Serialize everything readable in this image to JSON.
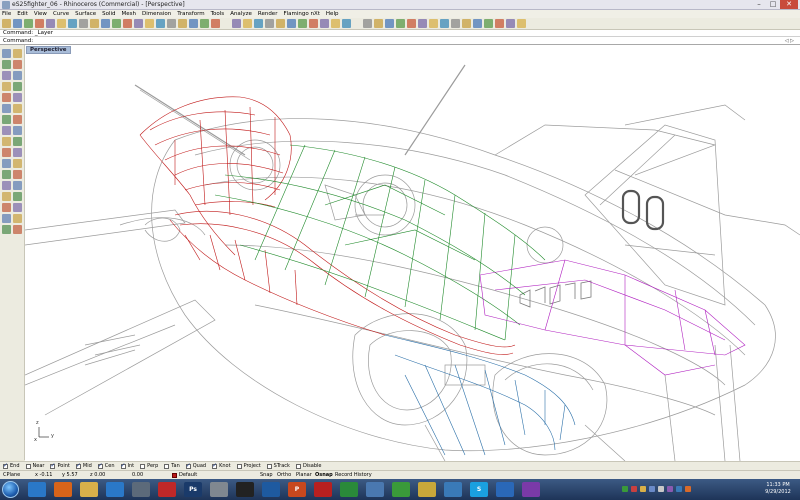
{
  "window": {
    "title": "eS25fighter_06 - Rhinoceros (Commercial) - [Perspective]"
  },
  "menu": [
    "File",
    "Edit",
    "View",
    "Curve",
    "Surface",
    "Solid",
    "Mesh",
    "Dimension",
    "Transform",
    "Tools",
    "Analyze",
    "Render",
    "Flamingo nXt",
    "Help"
  ],
  "toolbar": {
    "icons": [
      "new-icon",
      "open-icon",
      "save-icon",
      "print-icon",
      "import-icon",
      "cut-icon",
      "copy-icon",
      "paste-icon",
      "undo-icon",
      "redo-icon",
      "pan-icon",
      "rotate-icon",
      "zoom-icon",
      "zoom-window-icon",
      "zoom-extents-icon",
      "zoom-selected-icon",
      "zoom-target-icon",
      "undo-view-icon",
      "four-view-icon",
      "cplane-icon",
      "layer-icon",
      "properties-icon",
      "select-icon",
      "lights-icon",
      "rectangle-icon",
      "ellipse-icon",
      "select-points-icon",
      "ghosted-icon",
      "wireframe-icon",
      "shaded-icon",
      "rendered-icon",
      "render-icon",
      "lock-icon",
      "hide-icon",
      "snap-icon",
      "grid-icon",
      "analysis-icon",
      "options-icon",
      "mesh-icon",
      "flamingo-icon",
      "material-icon",
      "environment-icon",
      "light-icon",
      "camera-icon",
      "render-preview-icon",
      "help-icon"
    ]
  },
  "command": {
    "history": "Command: _Layer",
    "prompt_label": "Command:",
    "nav_arrows": "◁ ▷"
  },
  "viewport": {
    "tab_label": "Perspective",
    "axis_x": "x",
    "axis_y": "y",
    "axis_z": "z",
    "colors": {
      "background": "#ffffff",
      "red_wire": "#c01818",
      "green_wire": "#1f8a2a",
      "blue_wire": "#2a6fa8",
      "magenta_wire": "#b020c0",
      "grey_wire": "#7a7a7a"
    }
  },
  "osnap": [
    {
      "label": "End",
      "checked": true
    },
    {
      "label": "Near",
      "checked": false
    },
    {
      "label": "Point",
      "checked": true
    },
    {
      "label": "Mid",
      "checked": true
    },
    {
      "label": "Cen",
      "checked": true
    },
    {
      "label": "Int",
      "checked": true
    },
    {
      "label": "Perp",
      "checked": false
    },
    {
      "label": "Tan",
      "checked": false
    },
    {
      "label": "Quad",
      "checked": true
    },
    {
      "label": "Knot",
      "checked": true
    },
    {
      "label": "Project",
      "checked": false
    },
    {
      "label": "STrack",
      "checked": false
    },
    {
      "label": "Disable",
      "checked": false
    }
  ],
  "status": {
    "cplane": "CPlane",
    "x": "x -0.11",
    "y": "y 5.57",
    "z": "z 0.00",
    "distance": "0.00",
    "layer": "Default",
    "layer_color": "#b81818",
    "snap": "Snap",
    "ortho": "Ortho",
    "planar": "Planar",
    "osnap": "Osnap",
    "record_history": "Record History"
  },
  "taskbar": {
    "apps": [
      {
        "name": "ie-icon",
        "label": "",
        "color": "#2a78c8"
      },
      {
        "name": "firefox-icon",
        "label": "",
        "color": "#d8641a"
      },
      {
        "name": "explorer-icon",
        "label": "",
        "color": "#d8b04a"
      },
      {
        "name": "media-player-icon",
        "label": "",
        "color": "#2a78c8"
      },
      {
        "name": "rhino-icon",
        "label": "",
        "color": "#5c6a7a"
      },
      {
        "name": "autodesk-icon",
        "label": "",
        "color": "#c02828"
      },
      {
        "name": "photoshop-icon",
        "label": "Ps",
        "color": "#1a3a6a"
      },
      {
        "name": "alias-icon",
        "label": "",
        "color": "#808890"
      },
      {
        "name": "zbrush-icon",
        "label": "",
        "color": "#222222"
      },
      {
        "name": "keyshot-icon",
        "label": "",
        "color": "#1e5aa0"
      },
      {
        "name": "powerpoint-icon",
        "label": "P",
        "color": "#c8481e"
      },
      {
        "name": "pdf-icon",
        "label": "",
        "color": "#b82020"
      },
      {
        "name": "chrome-icon",
        "label": "",
        "color": "#2a8a3a"
      },
      {
        "name": "app-icon",
        "label": "",
        "color": "#4a78b0"
      },
      {
        "name": "chat-icon",
        "label": "",
        "color": "#3a9a3a"
      },
      {
        "name": "notes-icon",
        "label": "",
        "color": "#c8a83a"
      },
      {
        "name": "network-icon",
        "label": "",
        "color": "#3a7ab8"
      },
      {
        "name": "skype-icon",
        "label": "S",
        "color": "#1aa0e0"
      },
      {
        "name": "writer-icon",
        "label": "",
        "color": "#2a68b8"
      },
      {
        "name": "eye-icon",
        "label": "",
        "color": "#7a3aa8"
      }
    ],
    "time": "11:33 PM",
    "date": "9/29/2012"
  }
}
